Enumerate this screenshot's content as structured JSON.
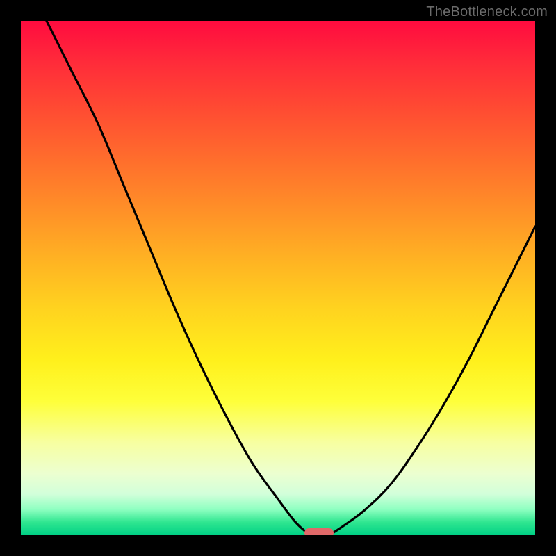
{
  "watermark": "TheBottleneck.com",
  "chart_data": {
    "type": "line",
    "title": "",
    "xlabel": "",
    "ylabel": "",
    "xlim": [
      0,
      100
    ],
    "ylim": [
      0,
      100
    ],
    "grid": false,
    "series": [
      {
        "name": "left-curve",
        "x": [
          5,
          10,
          15,
          20,
          25,
          30,
          35,
          40,
          45,
          50,
          53,
          55,
          56.5
        ],
        "values": [
          100,
          90,
          80,
          68,
          56,
          44,
          33,
          23,
          14,
          7,
          3,
          1,
          0
        ]
      },
      {
        "name": "right-curve",
        "x": [
          60,
          63,
          67,
          72,
          77,
          82,
          87,
          92,
          97,
          100
        ],
        "values": [
          0,
          2,
          5,
          10,
          17,
          25,
          34,
          44,
          54,
          60
        ]
      }
    ],
    "marker": {
      "x": 58,
      "y": 0,
      "color": "#e06969"
    },
    "gradient_stops": [
      {
        "pos": 0,
        "color": "#ff0b3f"
      },
      {
        "pos": 50,
        "color": "#ffd31f"
      },
      {
        "pos": 85,
        "color": "#f7ffa1"
      },
      {
        "pos": 100,
        "color": "#00d085"
      }
    ]
  }
}
